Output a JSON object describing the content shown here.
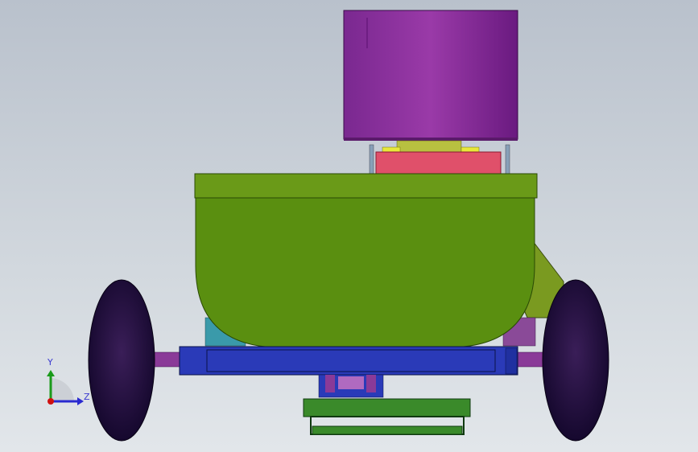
{
  "viewport": {
    "background_top": "#b9c1cc",
    "background_bottom": "#e2e6ea"
  },
  "model": {
    "colors": {
      "motor_housing": "#8a2a9a",
      "pink_roller": "#e0506a",
      "yellow_bracket": "#e0e040",
      "hopper": "#5a8f10",
      "hopper_rim": "#6a9a18",
      "axle_frame": "#2a3ab8",
      "axle_shaft": "#8a3a98",
      "tire": "#1c0a38",
      "teal_part": "#3a9aaa",
      "lower_tray": "#3a8a2a"
    }
  },
  "triad": {
    "y_label": "Y",
    "z_label": "Z",
    "y_color": "#1a9a1a",
    "z_color": "#2a2ad0",
    "origin_color": "#d01010"
  }
}
